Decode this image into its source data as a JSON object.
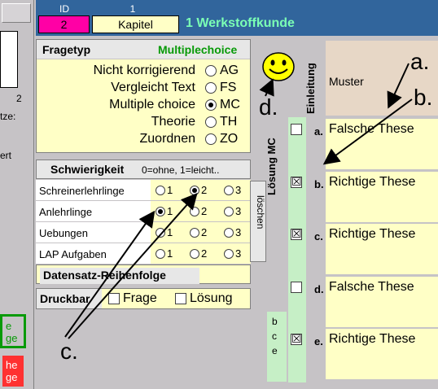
{
  "left": {
    "page_num": "2",
    "snippet1": "tze:",
    "snippet2": "ert",
    "btn_green": "e\nge",
    "btn_red": "he\nge"
  },
  "header": {
    "id_label": "ID",
    "id_value": "2",
    "kapitel_num": "1",
    "kapitel_label": "Kapitel",
    "kapitel_name": "1 Werkstoffkunde"
  },
  "fragetyp": {
    "title": "Fragetyp",
    "current": "Multiplechoice",
    "options": [
      {
        "label": "Nicht korrigierend",
        "code": "AG",
        "selected": false
      },
      {
        "label": "Vergleicht Text",
        "code": "FS",
        "selected": false
      },
      {
        "label": "Multiple choice",
        "code": "MC",
        "selected": true
      },
      {
        "label": "Theorie",
        "code": "TH",
        "selected": false
      },
      {
        "label": "Zuordnen",
        "code": "ZO",
        "selected": false
      }
    ]
  },
  "schwierigkeit": {
    "title": "Schwierigkeit",
    "hint": "0=ohne, 1=leicht..",
    "rows": [
      {
        "label": "Schreinerlehrlinge",
        "selected": 2
      },
      {
        "label": "Anlehrlinge",
        "selected": 1
      },
      {
        "label": "Uebungen",
        "selected": 0
      },
      {
        "label": "LAP Aufgaben",
        "selected": 0
      }
    ],
    "options": [
      "1",
      "2",
      "3"
    ],
    "loeschen": "löschen"
  },
  "datensatz": {
    "label": "Datensatz-Reihenfolge"
  },
  "druckbar": {
    "label": "Druckbar",
    "frage": "Frage",
    "loesung": "Lösung"
  },
  "einleitung": "Einleitung",
  "muster": "Muster",
  "loesung_mc": "Lösung MC",
  "bce": [
    "b",
    "c",
    "e"
  ],
  "answers": [
    {
      "letter": "a.",
      "text": "Falsche These",
      "correct": false
    },
    {
      "letter": "b.",
      "text": "Richtige These",
      "correct": true
    },
    {
      "letter": "c.",
      "text": "Richtige These",
      "correct": true
    },
    {
      "letter": "d.",
      "text": "Falsche These",
      "correct": false
    },
    {
      "letter": "e.",
      "text": "Richtige These",
      "correct": true
    }
  ],
  "annotations": {
    "a": "a.",
    "b": "b.",
    "c": "c.",
    "d": "d."
  },
  "colors": {
    "header": "#31659c",
    "id_bg": "#ff00a5",
    "yellow": "#ffffc6",
    "green_strip": "#c6efc6",
    "kapitel_text": "#7bffb5"
  },
  "icons": {
    "smiley": "smiley-icon"
  }
}
